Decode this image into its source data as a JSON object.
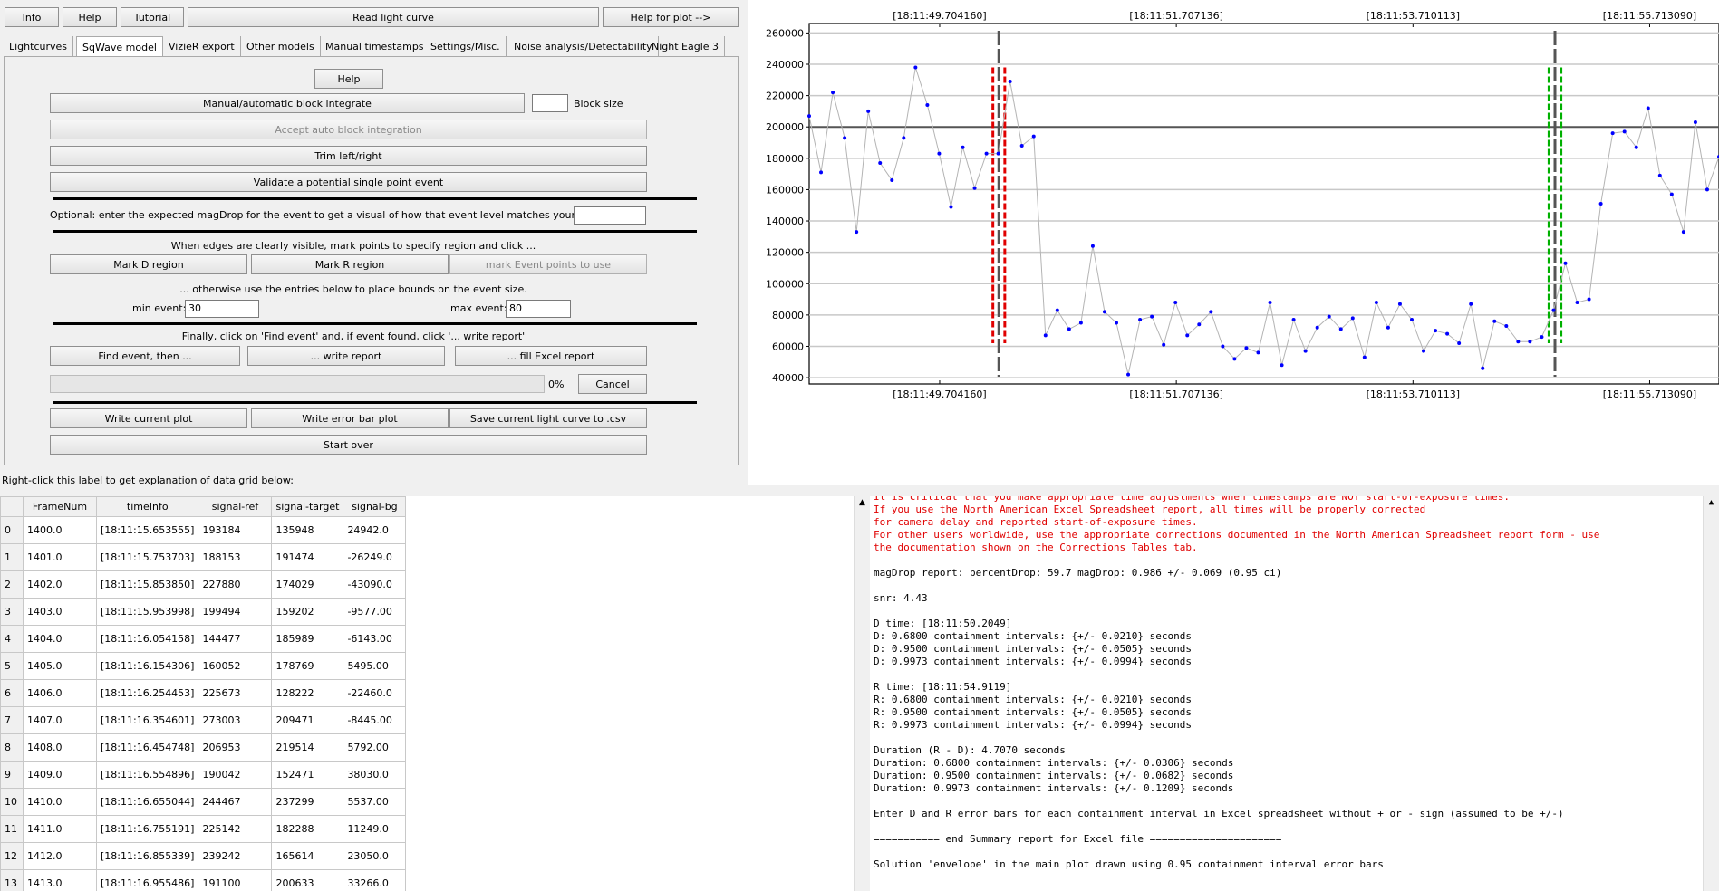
{
  "toolbar": {
    "info": "Info",
    "help": "Help",
    "tutorial": "Tutorial",
    "read_light_curve": "Read light curve",
    "help_for_plot": "Help for plot -->"
  },
  "tabs": [
    "Lightcurves",
    "SqWave model",
    "VizieR export",
    "Other models",
    "Manual timestamps",
    "Settings/Misc.",
    "Noise analysis/Detectability",
    "Night Eagle 3"
  ],
  "active_tab": "SqWave model",
  "panel": {
    "help": "Help",
    "manual_block": "Manual/automatic block integrate",
    "block_size_label": "Block size",
    "block_size_value": "",
    "accept_auto": "Accept auto block integration",
    "trim": "Trim left/right",
    "validate": "Validate a potential single point event",
    "optional_text": "Optional: enter the expected magDrop for the event to get a visual of how that event level matches your observation.",
    "magdrop_value": "",
    "edges_text": "When edges are clearly visible, mark points to specify region and click ...",
    "mark_d": "Mark D region",
    "mark_r": "Mark R region",
    "mark_event": "mark Event points to use",
    "otherwise_text": "... otherwise use the entries below to place bounds on the event size.",
    "min_event_label": "min event:",
    "min_event_value": "30",
    "max_event_label": "max event:",
    "max_event_value": "80",
    "finally_text": "Finally, click on 'Find event' and, if event found, click '... write report'",
    "find_event": "Find event, then ...",
    "write_report": "... write report",
    "fill_excel": "... fill Excel report",
    "progress_pct": "0%",
    "progress_value": 0,
    "cancel": "Cancel",
    "write_plot": "Write current plot",
    "write_error_bar": "Write error bar plot",
    "save_csv": "Save current light curve to .csv",
    "start_over": "Start over"
  },
  "grid_hint": "Right-click this label to get explanation of data grid below:",
  "table": {
    "columns": [
      "FrameNum",
      "timeInfo",
      "signal-ref",
      "signal-target",
      "signal-bg"
    ],
    "rows": [
      [
        "0",
        "1400.0",
        "[18:11:15.653555]",
        "193184",
        "135948",
        "24942.0"
      ],
      [
        "1",
        "1401.0",
        "[18:11:15.753703]",
        "188153",
        "191474",
        "-26249.0"
      ],
      [
        "2",
        "1402.0",
        "[18:11:15.853850]",
        "227880",
        "174029",
        "-43090.0"
      ],
      [
        "3",
        "1403.0",
        "[18:11:15.953998]",
        "199494",
        "159202",
        "-9577.00"
      ],
      [
        "4",
        "1404.0",
        "[18:11:16.054158]",
        "144477",
        "185989",
        "-6143.00"
      ],
      [
        "5",
        "1405.0",
        "[18:11:16.154306]",
        "160052",
        "178769",
        "5495.00"
      ],
      [
        "6",
        "1406.0",
        "[18:11:16.254453]",
        "225673",
        "128222",
        "-22460.0"
      ],
      [
        "7",
        "1407.0",
        "[18:11:16.354601]",
        "273003",
        "209471",
        "-8445.00"
      ],
      [
        "8",
        "1408.0",
        "[18:11:16.454748]",
        "206953",
        "219514",
        "5792.00"
      ],
      [
        "9",
        "1409.0",
        "[18:11:16.554896]",
        "190042",
        "152471",
        "38030.0"
      ],
      [
        "10",
        "1410.0",
        "[18:11:16.655044]",
        "244467",
        "237299",
        "5537.00"
      ],
      [
        "11",
        "1411.0",
        "[18:11:16.755191]",
        "225142",
        "182288",
        "11249.0"
      ],
      [
        "12",
        "1412.0",
        "[18:11:16.855339]",
        "239242",
        "165614",
        "23050.0"
      ],
      [
        "13",
        "1413.0",
        "[18:11:16.955486]",
        "191100",
        "200633",
        "33266.0"
      ]
    ]
  },
  "report": [
    {
      "text": "It is critical that you make appropriate time adjustments when timestamps are NOT start-of-exposure times.",
      "red": true
    },
    {
      "text": "If you use the North American Excel Spreadsheet report, all times will be properly corrected",
      "red": true
    },
    {
      "text": "for camera delay and reported start-of-exposure times.",
      "red": true
    },
    {
      "text": "For other users worldwide, use the appropriate corrections documented in the North American Spreadsheet report form - use",
      "red": true
    },
    {
      "text": "the documentation shown on the Corrections Tables tab.",
      "red": true
    },
    {
      "text": "",
      "red": false
    },
    {
      "text": "magDrop report: percentDrop: 59.7 magDrop: 0.986 +/- 0.069 (0.95 ci)",
      "red": false
    },
    {
      "text": "",
      "red": false
    },
    {
      "text": "snr: 4.43",
      "red": false
    },
    {
      "text": "",
      "red": false
    },
    {
      "text": "D time: [18:11:50.2049]",
      "red": false
    },
    {
      "text": "D: 0.6800 containment intervals: {+/- 0.0210} seconds",
      "red": false
    },
    {
      "text": "D: 0.9500 containment intervals: {+/- 0.0505} seconds",
      "red": false
    },
    {
      "text": "D: 0.9973 containment intervals: {+/- 0.0994} seconds",
      "red": false
    },
    {
      "text": "",
      "red": false
    },
    {
      "text": "R time: [18:11:54.9119]",
      "red": false
    },
    {
      "text": "R: 0.6800 containment intervals: {+/- 0.0210} seconds",
      "red": false
    },
    {
      "text": "R: 0.9500 containment intervals: {+/- 0.0505} seconds",
      "red": false
    },
    {
      "text": "R: 0.9973 containment intervals: {+/- 0.0994} seconds",
      "red": false
    },
    {
      "text": "",
      "red": false
    },
    {
      "text": "Duration (R - D): 4.7070 seconds",
      "red": false
    },
    {
      "text": "Duration: 0.6800 containment intervals: {+/- 0.0306} seconds",
      "red": false
    },
    {
      "text": "Duration: 0.9500 containment intervals: {+/- 0.0682} seconds",
      "red": false
    },
    {
      "text": "Duration: 0.9973 containment intervals: {+/- 0.1209} seconds",
      "red": false
    },
    {
      "text": "",
      "red": false
    },
    {
      "text": "Enter D and R error bars for each containment interval in Excel spreadsheet without + or - sign (assumed to be +/-)",
      "red": false
    },
    {
      "text": "",
      "red": false
    },
    {
      "text": "=========== end Summary report for Excel file ======================",
      "red": false
    },
    {
      "text": "",
      "red": false
    },
    {
      "text": "Solution 'envelope' in the main plot drawn using 0.95 containment interval error bars",
      "red": false
    }
  ],
  "colors": {
    "point": "#0000ff",
    "line": "#b4b4b4",
    "d_band": "#e00000",
    "r_band": "#00b000",
    "edge": "#555555",
    "grid": "#c8c8c8"
  },
  "chart_data": {
    "type": "line",
    "title": "",
    "xlabel": "",
    "ylabel": "",
    "x_tick_labels": [
      "[18:11:49.704160]",
      "[18:11:51.707136]",
      "[18:11:53.710113]",
      "[18:11:55.713090]"
    ],
    "x_tick_values": [
      49.70416,
      51.707136,
      53.710113,
      55.71309
    ],
    "xlim": [
      48.6,
      56.3
    ],
    "y_ticks": [
      40000,
      60000,
      80000,
      100000,
      120000,
      140000,
      160000,
      180000,
      200000,
      220000,
      240000,
      260000
    ],
    "ylim": [
      36000,
      266000
    ],
    "baseline_level": 200000,
    "d_edge_x": 50.2049,
    "r_edge_x": 54.9119,
    "d_band_x": [
      50.1544,
      50.2554
    ],
    "r_band_x": [
      54.8614,
      54.9624
    ],
    "series": [
      {
        "points": [
          [
            48.6,
            207000
          ],
          [
            48.7,
            171000
          ],
          [
            48.8,
            222000
          ],
          [
            48.9,
            193000
          ],
          [
            49.0,
            133000
          ],
          [
            49.1,
            210000
          ],
          [
            49.2,
            177000
          ],
          [
            49.3,
            166000
          ],
          [
            49.4,
            193000
          ],
          [
            49.5,
            238000
          ],
          [
            49.6,
            214000
          ],
          [
            49.7,
            183000
          ],
          [
            49.8,
            149000
          ],
          [
            49.9,
            187000
          ],
          [
            50.0,
            161000
          ],
          [
            50.1,
            183000
          ],
          [
            50.2,
            183000
          ],
          [
            50.3,
            229000
          ],
          [
            50.4,
            188000
          ],
          [
            50.5,
            194000
          ],
          [
            50.6,
            67000
          ],
          [
            50.7,
            83000
          ],
          [
            50.8,
            71000
          ],
          [
            50.9,
            75000
          ],
          [
            51.0,
            124000
          ],
          [
            51.1,
            82000
          ],
          [
            51.2,
            75000
          ],
          [
            51.3,
            42000
          ],
          [
            51.4,
            77000
          ],
          [
            51.5,
            79000
          ],
          [
            51.6,
            61000
          ],
          [
            51.7,
            88000
          ],
          [
            51.8,
            67000
          ],
          [
            51.9,
            74000
          ],
          [
            52.0,
            82000
          ],
          [
            52.1,
            60000
          ],
          [
            52.2,
            52000
          ],
          [
            52.3,
            59000
          ],
          [
            52.4,
            56000
          ],
          [
            52.5,
            88000
          ],
          [
            52.6,
            48000
          ],
          [
            52.7,
            77000
          ],
          [
            52.8,
            57000
          ],
          [
            52.9,
            72000
          ],
          [
            53.0,
            79000
          ],
          [
            53.1,
            71000
          ],
          [
            53.2,
            78000
          ],
          [
            53.3,
            53000
          ],
          [
            53.4,
            88000
          ],
          [
            53.5,
            72000
          ],
          [
            53.6,
            87000
          ],
          [
            53.7,
            77000
          ],
          [
            53.8,
            57000
          ],
          [
            53.9,
            70000
          ],
          [
            54.0,
            68000
          ],
          [
            54.1,
            62000
          ],
          [
            54.2,
            87000
          ],
          [
            54.3,
            46000
          ],
          [
            54.4,
            76000
          ],
          [
            54.5,
            73000
          ],
          [
            54.6,
            63000
          ],
          [
            54.7,
            63000
          ],
          [
            54.8,
            66000
          ],
          [
            54.9,
            83000
          ],
          [
            55.0,
            113000
          ],
          [
            55.1,
            88000
          ],
          [
            55.2,
            90000
          ],
          [
            55.3,
            151000
          ],
          [
            55.4,
            196000
          ],
          [
            55.5,
            197000
          ],
          [
            55.6,
            187000
          ],
          [
            55.7,
            212000
          ],
          [
            55.8,
            169000
          ],
          [
            55.9,
            157000
          ],
          [
            56.0,
            133000
          ],
          [
            56.1,
            203000
          ],
          [
            56.2,
            160000
          ],
          [
            56.3,
            181000
          ]
        ]
      }
    ]
  }
}
